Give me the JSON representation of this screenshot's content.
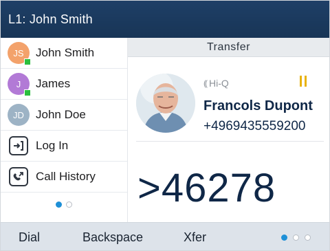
{
  "topbar": {
    "title": "L1: John Smith"
  },
  "sidebar": {
    "items": [
      {
        "label": "John Smith",
        "initials": "JS",
        "avatar_color": "#f3a26b",
        "presence": true
      },
      {
        "label": "James",
        "initials": "J",
        "avatar_color": "#b27ad6",
        "presence": true
      },
      {
        "label": "John Doe",
        "initials": "JD",
        "avatar_color": "#9db3c5",
        "presence": false
      },
      {
        "label": "Log In",
        "icon": "login-icon"
      },
      {
        "label": "Call History",
        "icon": "call-history-icon"
      }
    ],
    "pager": {
      "current": 1,
      "total": 2
    }
  },
  "main": {
    "header": "Transfer",
    "contact": {
      "name": "Francols Dupont",
      "number": "+4969435559200",
      "hd_label": "Hi-Q"
    },
    "call_state_icon": "pause-icon",
    "dialed_number": ">46278"
  },
  "softkeys": {
    "keys": [
      "Dial",
      "Backspace",
      "Xfer"
    ],
    "pager": {
      "current": 1,
      "total": 3
    }
  },
  "colors": {
    "topbar": "#1e3f67",
    "accent": "#1e90d7",
    "presence": "#2bbf3e",
    "hold": "#e8b20c"
  }
}
